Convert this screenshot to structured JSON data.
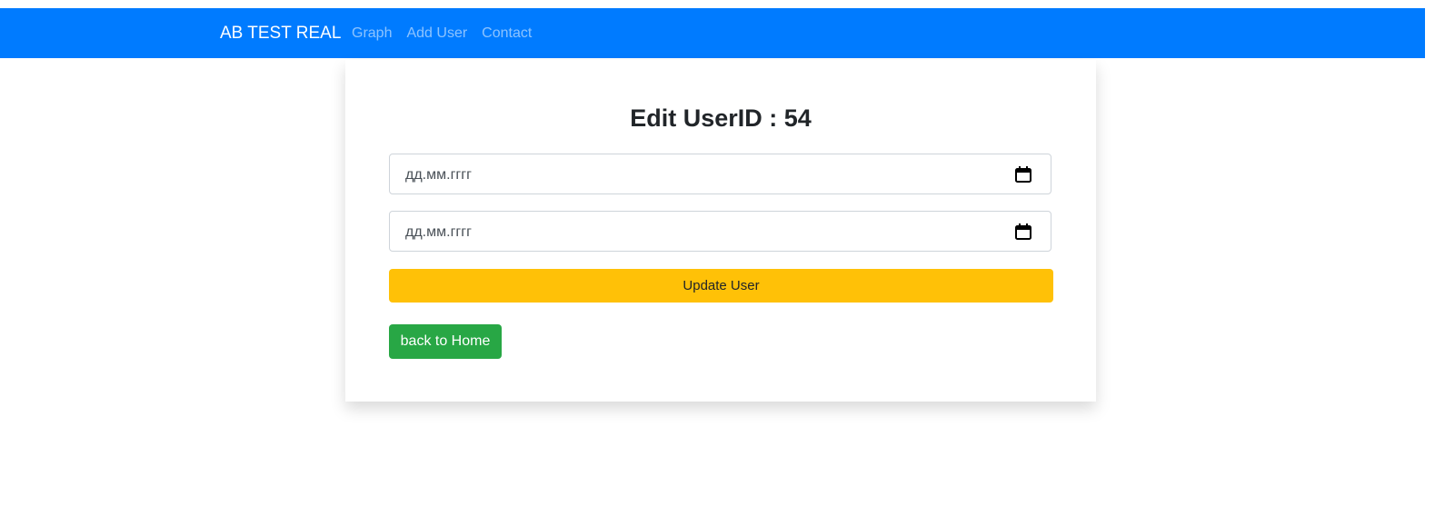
{
  "navbar": {
    "brand": "AB TEST REAL",
    "links": [
      "Graph",
      "Add User",
      "Contact"
    ],
    "color": "#007bff"
  },
  "form": {
    "title": "Edit UserID : 54",
    "date_field_1": {
      "placeholder": "дд.мм.гггг"
    },
    "date_field_2": {
      "placeholder": "дд.мм.гггг"
    },
    "update_label": "Update User",
    "back_label": "back to Home"
  },
  "colors": {
    "update_button": "#ffc107",
    "back_button": "#28a745"
  },
  "icons": {
    "date_picker": "calendar-icon"
  }
}
